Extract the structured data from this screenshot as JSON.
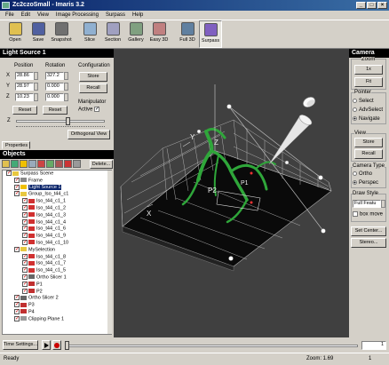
{
  "window": {
    "title": "Zc2czoSmall - Imaris 3.2",
    "controls": [
      "_",
      "□",
      "×"
    ]
  },
  "menu": [
    "File",
    "Edit",
    "View",
    "Image Processing",
    "Surpass",
    "Help"
  ],
  "toolbar": [
    {
      "label": "Open",
      "icon": "open-folder-icon",
      "color": "#e0c050"
    },
    {
      "label": "Save",
      "icon": "save-disk-icon",
      "color": "#5060a0"
    },
    {
      "label": "Snapshot",
      "icon": "camera-icon",
      "color": "#707070"
    },
    {
      "label": "Slice",
      "icon": "slice-icon",
      "color": "#90b0d0"
    },
    {
      "label": "Section",
      "icon": "section-icon",
      "color": "#a0a0c0"
    },
    {
      "label": "Gallery",
      "icon": "gallery-icon",
      "color": "#80a080"
    },
    {
      "label": "Easy 3D",
      "icon": "easy3d-icon",
      "color": "#c08080"
    },
    {
      "label": "Full 3D",
      "icon": "full3d-icon",
      "color": "#6080a0"
    },
    {
      "label": "Surpass",
      "icon": "surpass-icon",
      "color": "#8060c0"
    }
  ],
  "light": {
    "header": "Light Source 1",
    "position_label": "Position",
    "rotation_label": "Rotation",
    "configuration_label": "Configuration",
    "x": "28.86",
    "y": "28.97",
    "z": "10.23",
    "rx": "327.2",
    "ry": "0.000",
    "rz": "0.000",
    "store": "Store",
    "recall": "Recall",
    "reset1": "Reset",
    "reset2": "Reset",
    "manipulator_label": "Manipulator",
    "active_label": "Active",
    "z_label": "Z",
    "ortho_view": "Orthogonal View",
    "props_tab": "Properties"
  },
  "objects": {
    "header": "Objects",
    "delete": "Delete...",
    "tree": [
      {
        "d": 0,
        "t": "Surpass Scene",
        "ic": "folder",
        "c": "#e8c840"
      },
      {
        "d": 1,
        "t": "Frame",
        "ic": "frame",
        "c": "#888"
      },
      {
        "d": 1,
        "t": "Light Source 1",
        "ic": "light",
        "c": "#f0c000",
        "sel": true
      },
      {
        "d": 1,
        "t": "Group_Iso_t44_c1",
        "ic": "folder",
        "c": "#e8c840"
      },
      {
        "d": 2,
        "t": "Iso_t44_c1_1",
        "ic": "iso",
        "c": "#d03030"
      },
      {
        "d": 2,
        "t": "Iso_t44_c1_2",
        "ic": "iso",
        "c": "#d03030"
      },
      {
        "d": 2,
        "t": "Iso_t44_c1_3",
        "ic": "iso",
        "c": "#d03030"
      },
      {
        "d": 2,
        "t": "Iso_t44_c1_4",
        "ic": "iso",
        "c": "#d03030"
      },
      {
        "d": 2,
        "t": "Iso_t44_c1_6",
        "ic": "iso",
        "c": "#d03030"
      },
      {
        "d": 2,
        "t": "Iso_t44_c1_9",
        "ic": "iso",
        "c": "#d03030"
      },
      {
        "d": 2,
        "t": "Iso_t44_c1_10",
        "ic": "iso",
        "c": "#d03030"
      },
      {
        "d": 1,
        "t": "MySelection",
        "ic": "folder",
        "c": "#e8c840"
      },
      {
        "d": 2,
        "t": "Iso_t44_c1_8",
        "ic": "iso",
        "c": "#d03030"
      },
      {
        "d": 2,
        "t": "Iso_t44_c1_7",
        "ic": "iso",
        "c": "#d03030"
      },
      {
        "d": 2,
        "t": "Iso_t44_c1_5",
        "ic": "iso",
        "c": "#d03030"
      },
      {
        "d": 2,
        "t": "Ortho Slicer 1",
        "ic": "slicer",
        "c": "#666"
      },
      {
        "d": 2,
        "t": "P1",
        "ic": "point",
        "c": "#c03030"
      },
      {
        "d": 2,
        "t": "P2",
        "ic": "point",
        "c": "#c03030"
      },
      {
        "d": 1,
        "t": "Ortho Slicer 2",
        "ic": "slicer",
        "c": "#666"
      },
      {
        "d": 1,
        "t": "P3",
        "ic": "point",
        "c": "#c03030"
      },
      {
        "d": 1,
        "t": "P4",
        "ic": "point",
        "c": "#c03030"
      },
      {
        "d": 1,
        "t": "Clipping Plane 1",
        "ic": "plane",
        "c": "#999"
      }
    ]
  },
  "camera": {
    "header": "Camera",
    "zoom_label": "Zoom",
    "zoom_1x": "1x",
    "fit": "Fit",
    "pointer_label": "Pointer",
    "select": "Select",
    "advselect": "AdvSelect",
    "navigate": "Navigate",
    "view_label": "View",
    "store": "Store",
    "recall": "Recall",
    "camtype_label": "Camera Type",
    "ortho": "Ortho",
    "perspec": "Perspec",
    "draw_label": "Draw Style",
    "draw_value": "Full Featu",
    "box_move": "box move",
    "set_center": "Set Center...",
    "stereo": "Stereo..."
  },
  "scene": {
    "axis_labels": [
      "X",
      "Y",
      "Z",
      "Z",
      "P1",
      "P2"
    ]
  },
  "time": {
    "settings": "Time Settings...",
    "frame": "1"
  },
  "status": {
    "left": "Ready",
    "zoom": "Zoom: 1.69",
    "right": "1"
  }
}
